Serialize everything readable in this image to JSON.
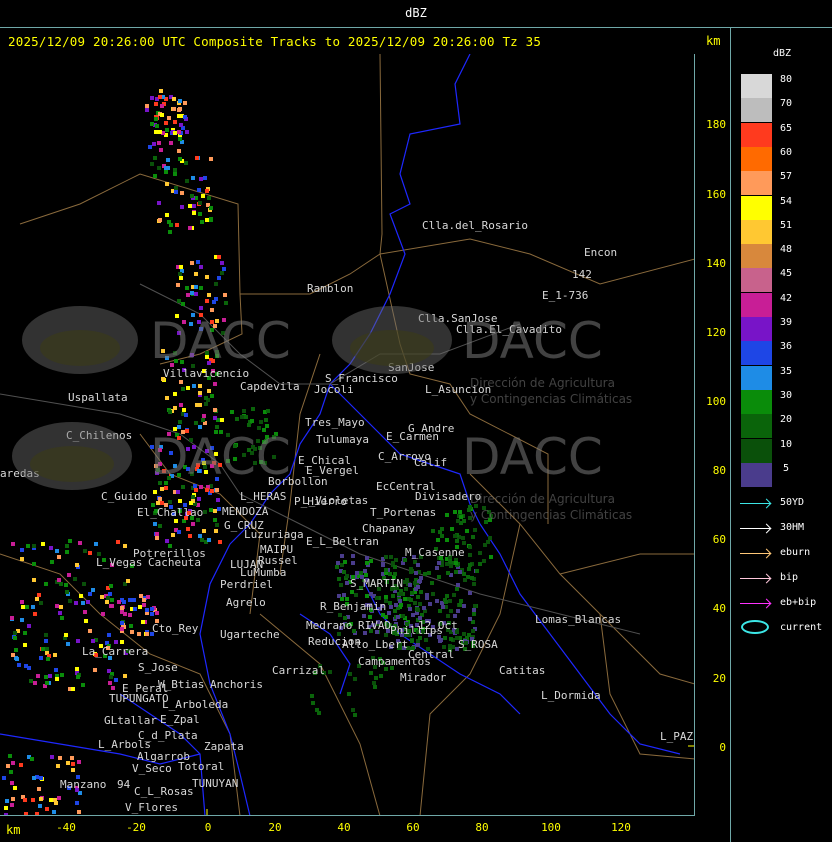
{
  "window": {
    "title": "dBZ"
  },
  "header": {
    "caption": "2025/12/09 20:26:00 UTC Composite Tracks to 2025/12/09 20:26:00 Tz 35",
    "unit_top": "km",
    "unit_bottom": "km"
  },
  "axes": {
    "y_ticks": [
      "180",
      "160",
      "140",
      "120",
      "100",
      "80",
      "60",
      "40",
      "20",
      "0"
    ],
    "x_ticks": [
      "-40",
      "-20",
      "0",
      "20",
      "40",
      "60",
      "80",
      "100",
      "120"
    ]
  },
  "legend": {
    "title": "dBZ",
    "levels": [
      {
        "label": "80",
        "color": "#d8d8d8"
      },
      {
        "label": "70",
        "color": "#bdbdbd"
      },
      {
        "label": "65",
        "color": "#ff3a1e"
      },
      {
        "label": "60",
        "color": "#ff6a00"
      },
      {
        "label": "57",
        "color": "#ff9a5a"
      },
      {
        "label": "54",
        "color": "#ffff00"
      },
      {
        "label": "51",
        "color": "#ffc832"
      },
      {
        "label": "48",
        "color": "#d8883c"
      },
      {
        "label": "45",
        "color": "#c8628c"
      },
      {
        "label": "42",
        "color": "#c81e96"
      },
      {
        "label": "39",
        "color": "#7814c8"
      },
      {
        "label": "36",
        "color": "#1e46e6"
      },
      {
        "label": "35",
        "color": "#1e8ce6"
      },
      {
        "label": "30",
        "color": "#0a8c0a"
      },
      {
        "label": "20",
        "color": "#0a640a"
      },
      {
        "label": "10",
        "color": "#0a500a"
      },
      {
        "label": "5",
        "color": "#4a3c8c"
      }
    ],
    "tracks": [
      {
        "label": "50YD",
        "color": "#3ce6e6"
      },
      {
        "label": "30HM",
        "color": "#ffffff"
      },
      {
        "label": "eburn",
        "color": "#ffc878"
      },
      {
        "label": "bip",
        "color": "#ffc8dc"
      },
      {
        "label": "eb+bip",
        "color": "#ff32ff"
      },
      {
        "label": "current",
        "color": "#3ce6e6"
      }
    ]
  },
  "watermark": {
    "brand": "DACC",
    "line1": "Dirección de Agricultura",
    "line2": "y Contingencias Climáticas"
  },
  "places": [
    {
      "name": "Clla.del_Rosario"
    },
    {
      "name": "Encon"
    },
    {
      "name": "142"
    },
    {
      "name": "E_1-736"
    },
    {
      "name": "Ramblon"
    },
    {
      "name": "Clla.SanJose"
    },
    {
      "name": "Clla.El_Cavadito"
    },
    {
      "name": "Villavicencio"
    },
    {
      "name": "S_Francisco"
    },
    {
      "name": "SanJose"
    },
    {
      "name": "Capdevila"
    },
    {
      "name": "Jocoli"
    },
    {
      "name": "L_Asuncion"
    },
    {
      "name": "Uspallata"
    },
    {
      "name": "Tres_Mayo"
    },
    {
      "name": "G_Andre"
    },
    {
      "name": "Tulumaya"
    },
    {
      "name": "E_Carmen"
    },
    {
      "name": "C_Chilenos"
    },
    {
      "name": "E_Chical"
    },
    {
      "name": "C_Arroyo"
    },
    {
      "name": "E_Vergel"
    },
    {
      "name": "Calif"
    },
    {
      "name": "aredas"
    },
    {
      "name": "Borbollon"
    },
    {
      "name": "EcCentral"
    },
    {
      "name": "Divisadero"
    },
    {
      "name": "L_Violetas"
    },
    {
      "name": "L_HERAS"
    },
    {
      "name": "C_Guido"
    },
    {
      "name": "P_Hierro"
    },
    {
      "name": "MENDOZA"
    },
    {
      "name": "T_Portenas"
    },
    {
      "name": "El_Challao"
    },
    {
      "name": "G_CRUZ"
    },
    {
      "name": "Luzuriaga"
    },
    {
      "name": "Chapanay"
    },
    {
      "name": "E_L_Beltran"
    },
    {
      "name": "Potrerillos"
    },
    {
      "name": "L_Vegas"
    },
    {
      "name": "Cacheuta"
    },
    {
      "name": "MAIPU"
    },
    {
      "name": "Russel"
    },
    {
      "name": "LUJAN"
    },
    {
      "name": "LuMumba"
    },
    {
      "name": "M_Casenne"
    },
    {
      "name": "S_MARTIN"
    },
    {
      "name": "Perdriel"
    },
    {
      "name": "Agrelo"
    },
    {
      "name": "R_Benjamin"
    },
    {
      "name": "La_Carrera"
    },
    {
      "name": "Ugarteche"
    },
    {
      "name": "Medrano"
    },
    {
      "name": "RIVAD"
    },
    {
      "name": "Phillips"
    },
    {
      "name": "12_Oct"
    },
    {
      "name": "Lomas_Blancas"
    },
    {
      "name": "Cto_Rey"
    },
    {
      "name": "S_Jose"
    },
    {
      "name": "Reducion"
    },
    {
      "name": "Alto_Lbert"
    },
    {
      "name": "Central"
    },
    {
      "name": "S_ROSA"
    },
    {
      "name": "Catitas"
    },
    {
      "name": "Campamentos"
    },
    {
      "name": "Carrizal"
    },
    {
      "name": "Mirador"
    },
    {
      "name": "E_Peral"
    },
    {
      "name": "W_Btias"
    },
    {
      "name": "Anchoris"
    },
    {
      "name": "L_Dormida"
    },
    {
      "name": "TUPUNGATO"
    },
    {
      "name": "L_Arboleda"
    },
    {
      "name": "GLtallar"
    },
    {
      "name": "E_Zpal"
    },
    {
      "name": "C_d_Plata"
    },
    {
      "name": "L_Arbols"
    },
    {
      "name": "Zapata"
    },
    {
      "name": "L_PAZ"
    },
    {
      "name": "Algarrob"
    },
    {
      "name": "V_Seco"
    },
    {
      "name": "Totoral"
    },
    {
      "name": "TUNUYAN"
    },
    {
      "name": "Manzano"
    },
    {
      "name": "94"
    },
    {
      "name": "C_L_Rosas"
    },
    {
      "name": "V_Flores"
    }
  ]
}
